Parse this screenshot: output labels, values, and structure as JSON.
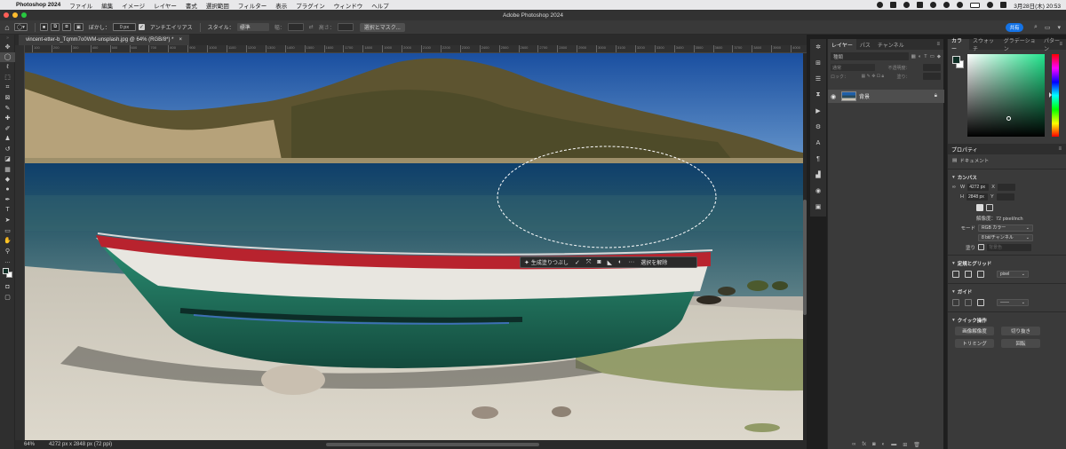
{
  "menubar": {
    "app_name": "Photoshop 2024",
    "items": [
      "ファイル",
      "編集",
      "イメージ",
      "レイヤー",
      "書式",
      "選択範囲",
      "フィルター",
      "表示",
      "プラグイン",
      "ウィンドウ",
      "ヘルプ"
    ],
    "datetime": "3月28日(木) 20:53"
  },
  "window": {
    "title": "Adobe Photoshop 2024"
  },
  "options": {
    "feather_label": "ぼかし：",
    "feather_value": "0 px",
    "antialias_label": "アンチエイリアス",
    "style_label": "スタイル：",
    "style_value": "標準",
    "width_label": "幅：",
    "height_label": "高さ：",
    "select_mask_button": "選択とマスク...",
    "share_button": "共有"
  },
  "document": {
    "tab_title": "vincent-etter-b_Tqmm7o0WM-unsplash.jpg @ 64% (RGB/8*) *",
    "ruler_ticks": [
      "100",
      "200",
      "300",
      "400",
      "500",
      "600",
      "700",
      "800",
      "900",
      "1000",
      "1100",
      "1200",
      "1300",
      "1400",
      "1500",
      "1600",
      "1700",
      "1800",
      "1900",
      "2000",
      "2100",
      "2200",
      "2300",
      "2400",
      "2500",
      "2600",
      "2700",
      "2800",
      "2900",
      "3000",
      "3100",
      "3200",
      "3300",
      "3400",
      "3500",
      "3600",
      "3700",
      "3800",
      "3900",
      "4000"
    ]
  },
  "context_bar": {
    "generative_fill": "生成塗りつぶし",
    "deselect": "選択を解除"
  },
  "status": {
    "zoom": "64%",
    "doc_info": "4272 px x 2848 px (72 ppi)"
  },
  "layers_panel": {
    "tabs": [
      "レイヤー",
      "パス",
      "チャンネル"
    ],
    "filter_placeholder": "種類",
    "blend_mode": "通常",
    "opacity_label": "不透明度：",
    "lock_label": "ロック：",
    "fill_label": "塗り：",
    "layer_name": "背景"
  },
  "color_panel": {
    "tabs": [
      "カラー",
      "スウォッチ",
      "グラデーション",
      "パターン"
    ],
    "foreground": "#0f2f26",
    "background": "#ffffff"
  },
  "properties": {
    "title": "プロパティ",
    "doc_label": "ドキュメント",
    "canvas_section": "カンバス",
    "w_label": "W",
    "w_value": "4272 px",
    "h_label": "H",
    "h_value": "2848 px",
    "x_label": "X",
    "y_label": "Y",
    "resolution": "解像度：72 pixel/inch",
    "mode_label": "モード",
    "mode_value": "RGB カラー",
    "bit_value": "8 bit/チャンネル",
    "fill_label": "塗り",
    "fill_value": "背景色",
    "rulers_section": "定規とグリッド",
    "unit_value": "pixel",
    "guides_section": "ガイド",
    "quick_section": "クイック操作",
    "quick_actions": [
      "画像解像度",
      "切り抜き",
      "トリミング",
      "回転"
    ]
  }
}
